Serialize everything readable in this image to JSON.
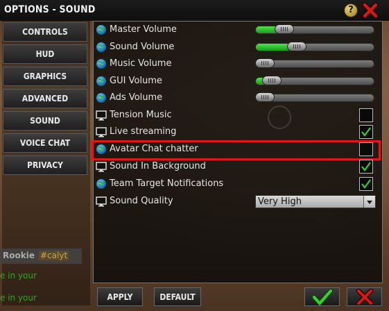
{
  "window": {
    "title": "OPTIONS - SOUND"
  },
  "sidebar": {
    "items": [
      {
        "label": "CONTROLS"
      },
      {
        "label": "HUD"
      },
      {
        "label": "GRAPHICS"
      },
      {
        "label": "ADVANCED"
      },
      {
        "label": "SOUND"
      },
      {
        "label": "VOICE CHAT"
      },
      {
        "label": "PRIVACY"
      }
    ]
  },
  "background_chat": {
    "rank": "Rookie",
    "channel": "#calyt",
    "line1": "e in your",
    "line2": "e in your"
  },
  "settings": [
    {
      "label": "Master Volume",
      "icon": "globe-icon",
      "control": "slider",
      "value": 0.24
    },
    {
      "label": "Sound Volume",
      "icon": "globe-icon",
      "control": "slider",
      "value": 0.35
    },
    {
      "label": "Music Volume",
      "icon": "globe-icon",
      "control": "slider",
      "value": 0.0
    },
    {
      "label": "GUI Volume",
      "icon": "globe-icon",
      "control": "slider",
      "value": 0.1
    },
    {
      "label": "Ads Volume",
      "icon": "globe-icon",
      "control": "slider",
      "value": 0.0
    },
    {
      "label": "Tension Music",
      "icon": "monitor-icon",
      "control": "checkbox",
      "checked": false
    },
    {
      "label": "Live streaming",
      "icon": "monitor-icon",
      "control": "checkbox",
      "checked": true
    },
    {
      "label": "Avatar Chat chatter",
      "icon": "globe-icon",
      "control": "checkbox",
      "checked": false
    },
    {
      "label": "Sound In Background",
      "icon": "monitor-icon",
      "control": "checkbox",
      "checked": true
    },
    {
      "label": "Team Target Notifications",
      "icon": "globe-icon",
      "control": "checkbox",
      "checked": true
    },
    {
      "label": "Sound Quality",
      "icon": "monitor-icon",
      "control": "select",
      "value": "Very High"
    }
  ],
  "footer": {
    "apply_label": "APPLY",
    "default_label": "DEFAULT"
  },
  "colors": {
    "accent_green": "#22c022",
    "highlight_red": "#e4141b",
    "close_red": "#d21a1a"
  }
}
